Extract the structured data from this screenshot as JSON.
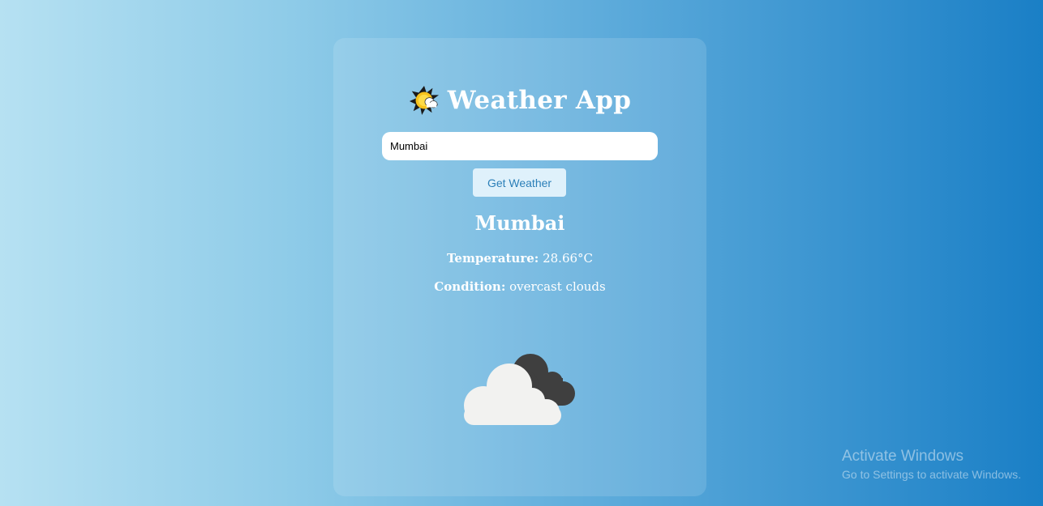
{
  "app": {
    "title": "Weather App",
    "title_icon": "sun-behind-cloud-icon"
  },
  "search": {
    "value": "Mumbai",
    "button_label": "Get Weather"
  },
  "result": {
    "city": "Mumbai",
    "temperature_label": "Temperature:",
    "temperature_value": "28.66°C",
    "condition_label": "Condition:",
    "condition_value": "overcast clouds",
    "icon": "overcast-clouds-icon"
  },
  "os_overlay": {
    "line1": "Activate Windows",
    "line2": "Go to Settings to activate Windows."
  }
}
